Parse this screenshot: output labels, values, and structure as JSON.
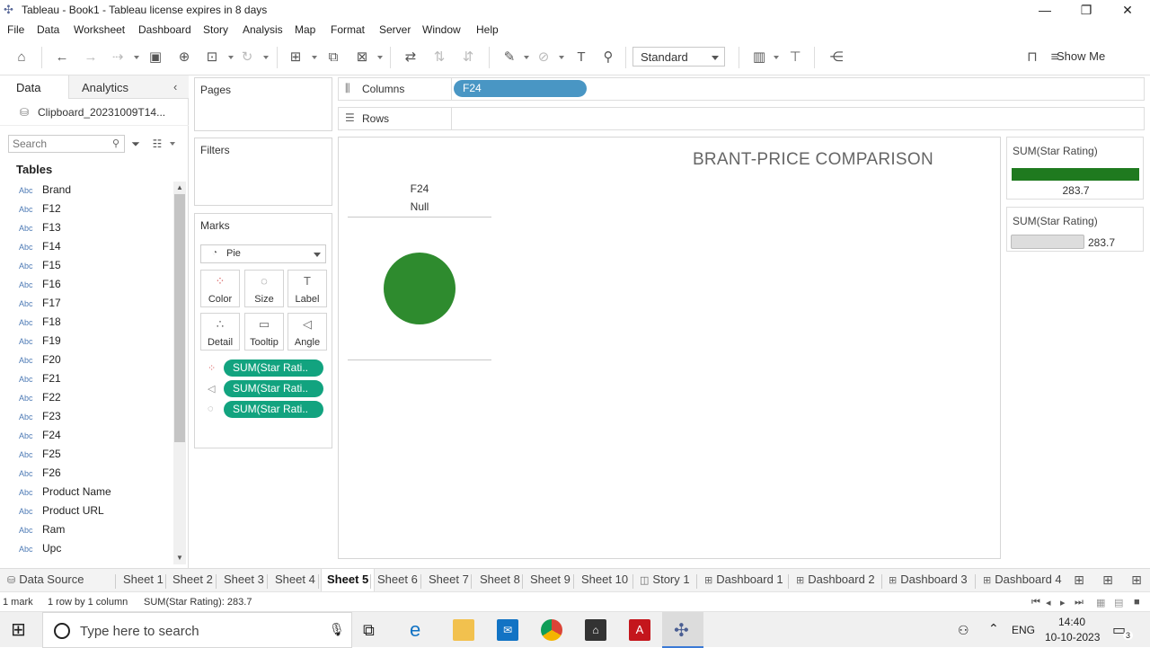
{
  "window": {
    "title": "Tableau - Book1 - Tableau license expires in 8 days"
  },
  "menu": [
    "File",
    "Data",
    "Worksheet",
    "Dashboard",
    "Story",
    "Analysis",
    "Map",
    "Format",
    "Server",
    "Window",
    "Help"
  ],
  "toolbar": {
    "fit_mode": "Standard",
    "show_me": "Show Me"
  },
  "datapane": {
    "tab_data": "Data",
    "tab_analytics": "Analytics",
    "datasource": "Clipboard_20231009T14...",
    "search_placeholder": "Search",
    "tables_header": "Tables",
    "field_type": "Abc",
    "fields": [
      "Brand",
      "F12",
      "F13",
      "F14",
      "F15",
      "F16",
      "F17",
      "F18",
      "F19",
      "F20",
      "F21",
      "F22",
      "F23",
      "F24",
      "F25",
      "F26",
      "Product Name",
      "Product URL",
      "Ram",
      "Upc"
    ]
  },
  "cards": {
    "pages": "Pages",
    "filters": "Filters",
    "marks": "Marks",
    "mark_type": "Pie",
    "buttons": {
      "color": "Color",
      "size": "Size",
      "label": "Label",
      "detail": "Detail",
      "tooltip": "Tooltip",
      "angle": "Angle"
    },
    "pills": [
      "SUM(Star Rati..",
      "SUM(Star Rati..",
      "SUM(Star Rati.."
    ]
  },
  "shelves": {
    "columns": "Columns",
    "rows": "Rows",
    "columns_pill": "F24"
  },
  "viz": {
    "title": "BRANT-PRICE COMPARISON",
    "column_header": "F24",
    "column_value": "Null",
    "pie_color": "#2e8b2e"
  },
  "legends": [
    {
      "title": "SUM(Star Rating)",
      "value": "283.7",
      "color": "#1f7a1f"
    },
    {
      "title": "SUM(Star Rating)",
      "value": "283.7"
    }
  ],
  "sheet_tabs": {
    "datasource": "Data Source",
    "tabs": [
      "Sheet 1",
      "Sheet 2",
      "Sheet 3",
      "Sheet 4",
      "Sheet 5",
      "Sheet 6",
      "Sheet 7",
      "Sheet 8",
      "Sheet 9",
      "Sheet 10",
      "Story 1",
      "Dashboard 1",
      "Dashboard 2",
      "Dashboard 3",
      "Dashboard 4"
    ],
    "active": "Sheet 5"
  },
  "status": {
    "marks": "1 mark",
    "dims": "1 row by 1 column",
    "sum": "SUM(Star Rating): 283.7"
  },
  "taskbar": {
    "search_placeholder": "Type here to search",
    "lang": "ENG",
    "time": "14:40",
    "date": "10-10-2023",
    "notifications": "3"
  }
}
